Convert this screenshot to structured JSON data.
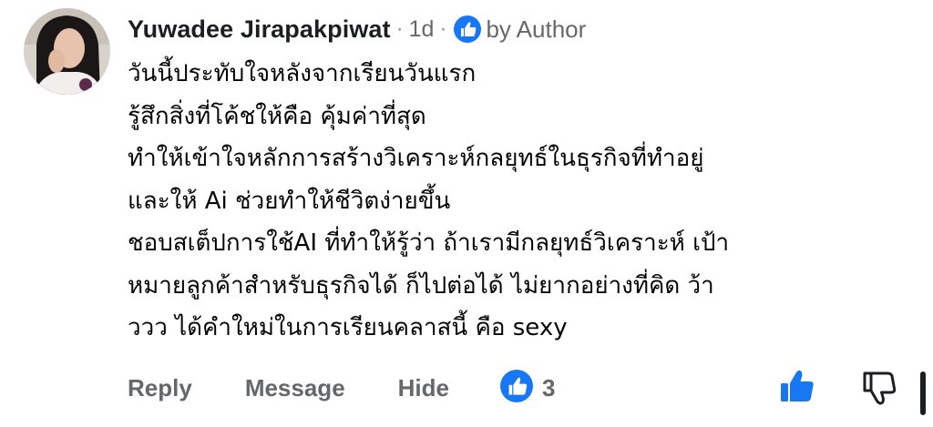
{
  "comment": {
    "author": "Yuwadee Jirapakpiwat",
    "separator": "·",
    "time": "1d",
    "liked_by_author_label": "by Author",
    "body_lines": [
      "วันนี้ประทับใจหลังจากเรียนวันแรก",
      "รู้สึกสิ่งที่โค้ชให้คือ คุ้มค่าที่สุด",
      "ทำให้เข้าใจหลักการสร้างวิเคราะห์กลยุทธ์ในธุรกิจที่ทำอยู่",
      "และให้ Ai ช่วยทำให้ชีวิตง่ายขึ้น",
      "ชอบสเต็ปการใช้AI ที่ทำให้รู้ว่า ถ้าเรามีกลยุทธ์วิเคราะห์ เป้า",
      "หมายลูกค้าสำหรับธุรกิจได้ ก็ไปต่อได้ ไม่ยากอย่างที่คิด ว้า",
      "ววว ได้คำใหม่ในการเรียนคลาสนี้ คือ sexy"
    ]
  },
  "actions": {
    "reply_label": "Reply",
    "message_label": "Message",
    "hide_label": "Hide",
    "like_count": "3"
  },
  "icons": {
    "like_badge": "thumbs-up-icon",
    "like_button": "thumbs-up-icon",
    "dislike_button": "thumbs-down-icon"
  },
  "colors": {
    "accent_blue": "#1877f2",
    "text_primary": "#050505",
    "text_secondary": "#65676b"
  }
}
